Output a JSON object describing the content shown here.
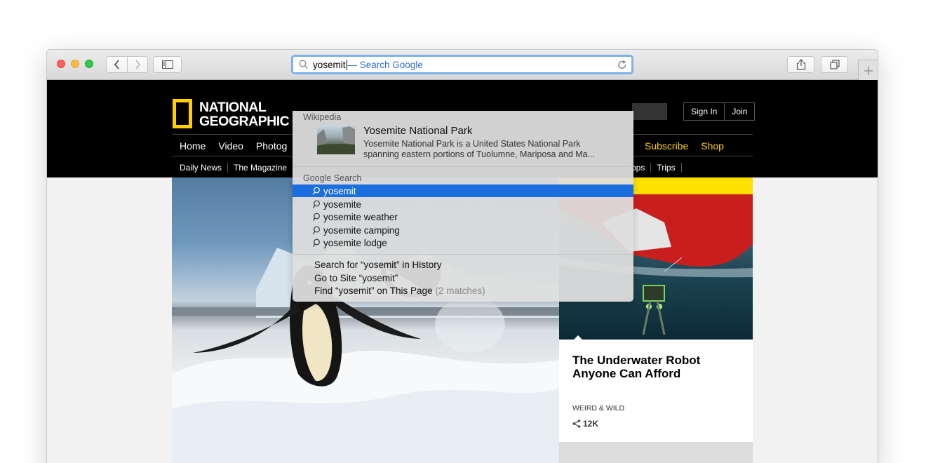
{
  "browser": {
    "address": {
      "typed": "yosemit",
      "hint": " — Search Google"
    }
  },
  "site": {
    "logo": {
      "line1": "NATIONAL",
      "line2": "GEOGRAPHIC"
    },
    "auth": {
      "sign_in": "Sign In",
      "join": "Join"
    },
    "nav_primary": [
      "Home",
      "Video",
      "Photog"
    ],
    "nav_primary_right": [
      "Subscribe",
      "Shop"
    ],
    "nav_secondary": [
      "Daily News",
      "The Magazine"
    ],
    "nav_secondary_right": [
      "ops",
      "Trips"
    ],
    "card": {
      "title": "The Underwater Robot Anyone Can Afford",
      "category": "WEIRD & WILD",
      "shares": "12K"
    },
    "colors": {
      "brand_yellow": "#ffcf01",
      "accent_yellow": "#ffe000"
    }
  },
  "dropdown": {
    "wikipedia": {
      "heading": "Wikipedia",
      "title": "Yosemite National Park",
      "desc_line1": "Yosemite National Park is a United States National Park",
      "desc_line2": "spanning eastern portions of Tuolumne, Mariposa and Ma..."
    },
    "google": {
      "heading": "Google Search",
      "suggestions": [
        "yosemit",
        "yosemite",
        "yosemite weather",
        "yosemite camping",
        "yosemite lodge"
      ]
    },
    "actions": {
      "history": "Search for “yosemit” in History",
      "go_to_site": "Go to Site “yosemit”",
      "find_on_page": "Find “yosemit” on This Page",
      "find_matches": "(2 matches)"
    },
    "colors": {
      "selection": "#1a6ede"
    }
  }
}
